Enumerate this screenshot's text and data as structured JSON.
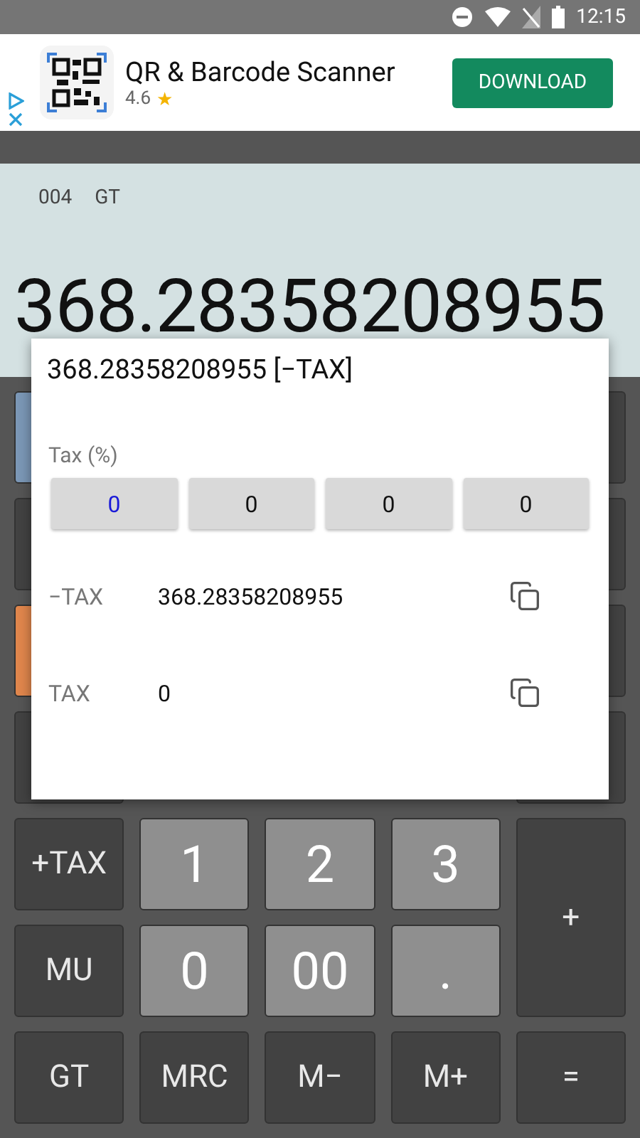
{
  "status_bar": {
    "time": "12:15"
  },
  "ad": {
    "app_name": "QR & Barcode Scanner",
    "rating": "4.6",
    "star": "★",
    "button": "DOWNLOAD"
  },
  "display": {
    "count": "004",
    "mode": "GT",
    "value": "368.28358208955"
  },
  "keypad": {
    "left_edge_keys": [
      {
        "kind": "accent",
        "color": "#7b97b6"
      },
      {
        "kind": "plain"
      },
      {
        "kind": "accent",
        "color": "#e0864c"
      },
      {
        "kind": "plain"
      }
    ],
    "right_edge_keys": [
      {
        "kind": "plain"
      },
      {
        "kind": "plain"
      },
      {
        "kind": "plain"
      },
      {
        "kind": "plain"
      }
    ],
    "keys": [
      {
        "label": "+TAX",
        "kind": "function"
      },
      {
        "label": "1",
        "kind": "digit"
      },
      {
        "label": "2",
        "kind": "digit"
      },
      {
        "label": "3",
        "kind": "digit"
      },
      {
        "label": "+",
        "kind": "tall"
      },
      {
        "label": "MU",
        "kind": "function"
      },
      {
        "label": "0",
        "kind": "digit"
      },
      {
        "label": "00",
        "kind": "digit"
      },
      {
        "label": ".",
        "kind": "digit"
      },
      {
        "label": "GT",
        "kind": "function"
      },
      {
        "label": "MRC",
        "kind": "function"
      },
      {
        "label": "M−",
        "kind": "function"
      },
      {
        "label": "M+",
        "kind": "function"
      },
      {
        "label": "=",
        "kind": "function"
      }
    ]
  },
  "dialog": {
    "title": "368.28358208955 [−TAX]",
    "tax_label": "Tax (%)",
    "tax_digits": [
      {
        "label": "0",
        "selected": true
      },
      {
        "label": "0",
        "selected": false
      },
      {
        "label": "0",
        "selected": false
      },
      {
        "label": "0",
        "selected": false
      }
    ],
    "results": [
      {
        "label": "−TAX",
        "value": "368.28358208955"
      },
      {
        "label": "TAX",
        "value": "0"
      }
    ]
  }
}
